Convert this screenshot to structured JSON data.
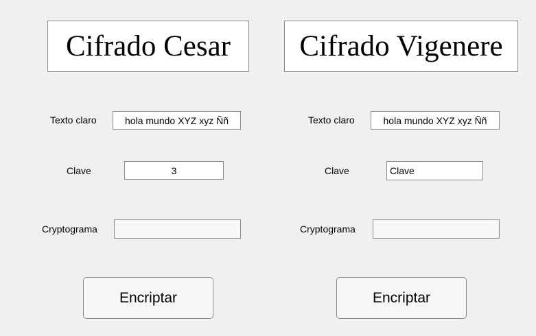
{
  "caesar": {
    "title": "Cifrado Cesar",
    "plaintext_label": "Texto claro",
    "plaintext_value": "hola mundo XYZ xyz Ññ",
    "key_label": "Clave",
    "key_value": "3",
    "cryptogram_label": "Cryptograma",
    "cryptogram_value": "",
    "encrypt_button": "Encriptar"
  },
  "vigenere": {
    "title": "Cifrado Vigenere",
    "plaintext_label": "Texto claro",
    "plaintext_value": "hola mundo XYZ xyz Ññ",
    "key_label": "Clave",
    "key_value": "Clave",
    "cryptogram_label": "Cryptograma",
    "cryptogram_value": "",
    "encrypt_button": "Encriptar"
  }
}
